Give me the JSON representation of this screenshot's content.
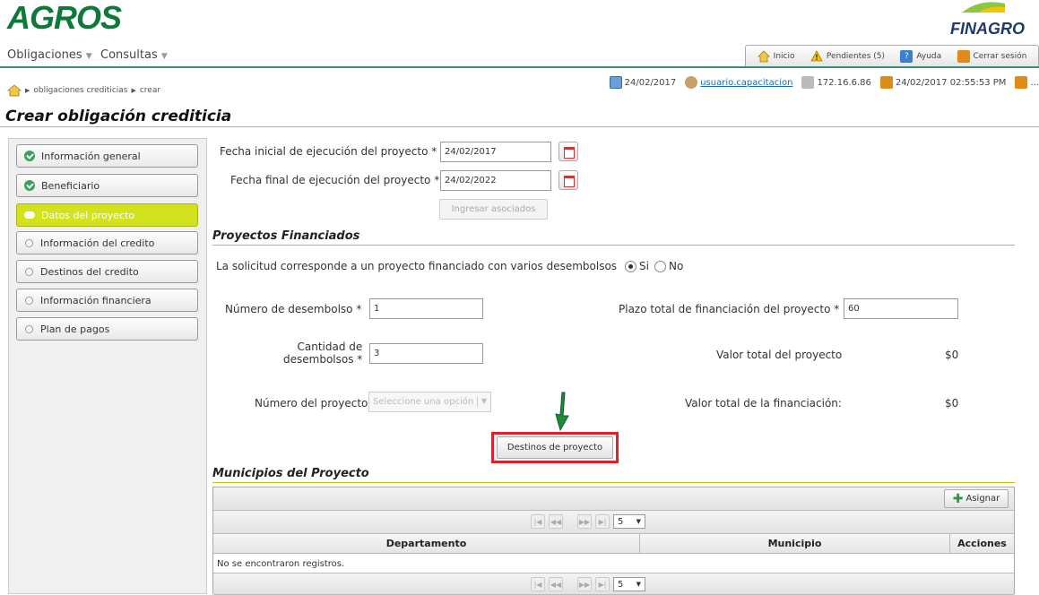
{
  "header": {
    "logo_left": "AGROS",
    "logo_right": "FINAGRO",
    "menu": [
      {
        "label": "Obligaciones"
      },
      {
        "label": "Consultas"
      }
    ],
    "nav": {
      "inicio": "Inicio",
      "pendientes": "Pendientes (5)",
      "ayuda": "Ayuda",
      "cerrar": "Cerrar sesión"
    }
  },
  "breadcrumb": {
    "items": [
      "obligaciones crediticias",
      "crear"
    ]
  },
  "status": {
    "date": "24/02/2017",
    "user": "usuario.capacitacion",
    "ip": "172.16.6.86",
    "datetime": "24/02/2017 02:55:53 PM",
    "extra": "..."
  },
  "page_title": "Crear obligación crediticia",
  "sidebar": {
    "items": [
      {
        "label": "Información general",
        "state": "done"
      },
      {
        "label": "Beneficiario",
        "state": "done"
      },
      {
        "label": "Datos del proyecto",
        "state": "active"
      },
      {
        "label": "Información del credito",
        "state": "pending"
      },
      {
        "label": "Destinos del credito",
        "state": "pending"
      },
      {
        "label": "Información financiera",
        "state": "pending"
      },
      {
        "label": "Plan de pagos",
        "state": "pending"
      }
    ]
  },
  "form": {
    "fecha_inicial_label": "Fecha inicial de ejecución del proyecto",
    "fecha_inicial_value": "24/02/2017",
    "fecha_final_label": "Fecha final de ejecución del proyecto",
    "fecha_final_value": "24/02/2022",
    "required_mark": "*",
    "ingresar_asociados": "Ingresar asociados",
    "proyectos_title": "Proyectos Financiados",
    "solicitud_label": "La solicitud corresponde a un proyecto financiado con varios desembolsos",
    "opt_si": "Si",
    "opt_no": "No",
    "numero_desembolso_label": "Número de desembolso",
    "numero_desembolso_value": "1",
    "plazo_label": "Plazo total de financiación del proyecto",
    "plazo_value": "60",
    "cantidad_label_1": "Cantidad de",
    "cantidad_label_2": "desembolsos",
    "cantidad_value": "3",
    "valor_proyecto_label": "Valor total del proyecto",
    "valor_proyecto_value": "$0",
    "numero_proyecto_label": "Número del proyecto",
    "numero_proyecto_placeholder": "Seleccione una opción",
    "valor_financiacion_label": "Valor total de la financiación:",
    "valor_financiacion_value": "$0",
    "destinos_button": "Destinos de proyecto"
  },
  "municipios": {
    "title": "Municipios del Proyecto",
    "asignar": "Asignar",
    "page_size": "5",
    "columns": [
      "Departamento",
      "Municipio",
      "Acciones"
    ],
    "empty_message": "No se encontraron registros."
  },
  "colors": {
    "brand_green": "#0e7a3a",
    "accent_lime": "#d2e21c",
    "highlight_red": "#e0212b",
    "arrow_green": "#1e8a3a"
  }
}
